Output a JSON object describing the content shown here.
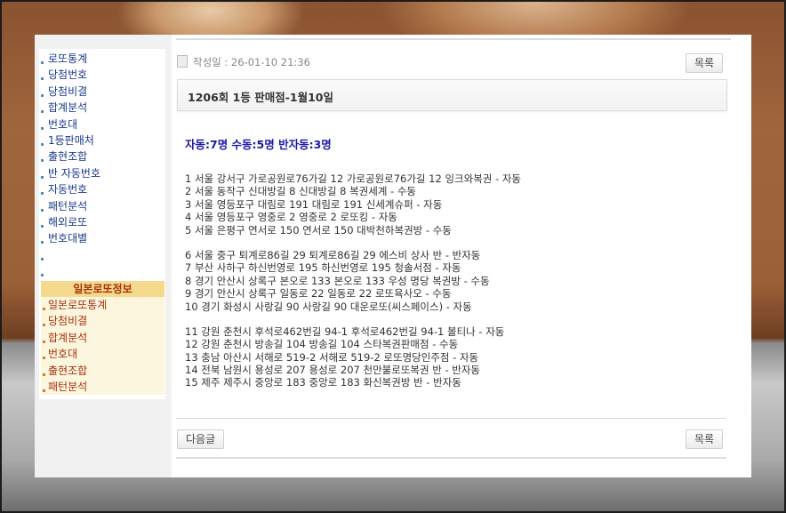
{
  "sidebar": {
    "items": [
      {
        "label": "로또통계"
      },
      {
        "label": "당첨번호"
      },
      {
        "label": "당첨비결"
      },
      {
        "label": "합계분석"
      },
      {
        "label": "번호대"
      },
      {
        "label": "1등판매처"
      },
      {
        "label": "출현조합"
      },
      {
        "label": "반 자동번호"
      },
      {
        "label": "자동번호"
      },
      {
        "label": "패턴분석"
      },
      {
        "label": "해외로또"
      },
      {
        "label": "번호대별"
      }
    ],
    "japan_header": "일본로또정보",
    "japan_items": [
      {
        "label": "일본로또통계"
      },
      {
        "label": "당첨비결"
      },
      {
        "label": "합계분석"
      },
      {
        "label": "번호대"
      },
      {
        "label": "출현조합"
      },
      {
        "label": "패턴분석"
      }
    ]
  },
  "post": {
    "date_label": "작성일 : 26-01-10 21:36",
    "list_button": "목록",
    "title": "1206회 1등 판매점-1월10일",
    "summary": "자동:7명 수동:5명 반자동:3명",
    "groups": [
      [
        "1 서울 강서구 가로공원로76가길 12 가로공원로76가길 12 잉크와복권 - 자동",
        "2 서울 동작구 신대방길 8 신대방길 8 복권세계 - 수동",
        "3 서울 영등포구 대림로 191 대림로 191 신세계슈퍼 - 자동",
        "4 서울 영등포구 영중로 2 영중로 2 로또킹 - 자동",
        "5 서울 은평구 연서로 150 연서로 150 대박천하복권방 - 수동"
      ],
      [
        "6 서울 중구 퇴계로86길 29 퇴계로86길 29 에스비 상사 반 - 반자동",
        "7 부산 사하구 하신번영로 195 하신번영로 195 청솔서점 - 자동",
        "8 경기 안산시 상록구 본오로 133 본오로 133 우성 명당 복권방 - 수동",
        "9 경기 안산시 상록구 일동로 22 일동로 22 로또육사오 - 수동",
        "10 경기 화성시 사랑길 90 사랑길 90 대운로또(씨스페이스) - 자동"
      ],
      [
        "11 강원 춘천시 후석로462번길 94-1 후석로462번길 94-1 볼티나 - 자동",
        "12 강원 춘천시 방송길 104 방송길 104 스타복권판매점 - 수동",
        "13 충남 아산시 서해로 519-2 서해로 519-2 로또명당인주점 - 자동",
        "14 전북 남원시 용성로 207 용성로 207 천만불로또복권 반 - 반자동",
        "15 제주 제주시 중앙로 183 중앙로 183 화신복권방 반 - 반자동"
      ]
    ],
    "next_button": "다음글"
  }
}
